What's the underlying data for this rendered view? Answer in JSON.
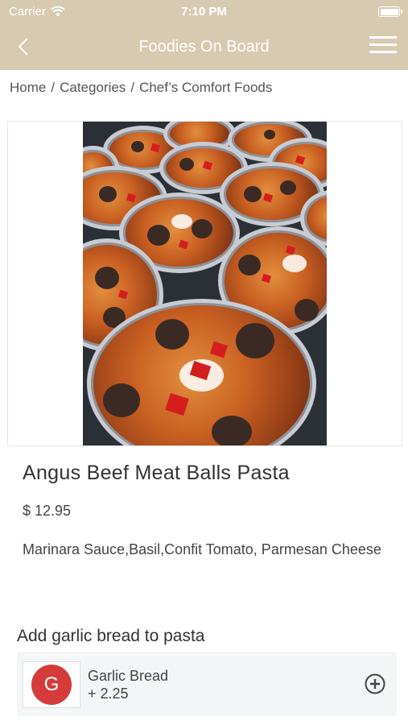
{
  "status_bar": {
    "carrier": "Carrier",
    "time": "7:10 PM"
  },
  "nav": {
    "title": "Foodies On Board"
  },
  "breadcrumb": [
    "Home",
    "Categories",
    "Chef’s Comfort Foods"
  ],
  "breadcrumb_separator": "/",
  "product": {
    "name": "Angus Beef Meat Balls Pasta",
    "price": "$ 12.95",
    "description": "Marinara Sauce,Basil,Confit Tomato, Parmesan Cheese"
  },
  "addon_section": {
    "title": "Add garlic bread to pasta",
    "items": [
      {
        "initial": "G",
        "name": "Garlic Bread",
        "price": "+ 2.25",
        "avatar_color": "#d63b3b"
      }
    ]
  },
  "colors": {
    "header": "#d7cab1",
    "accent_red": "#d63b3b"
  },
  "icons": {
    "back": "chevron-left-icon",
    "menu": "hamburger-menu-icon",
    "wifi": "wifi-icon",
    "battery": "battery-icon",
    "add": "plus-circle-icon"
  }
}
